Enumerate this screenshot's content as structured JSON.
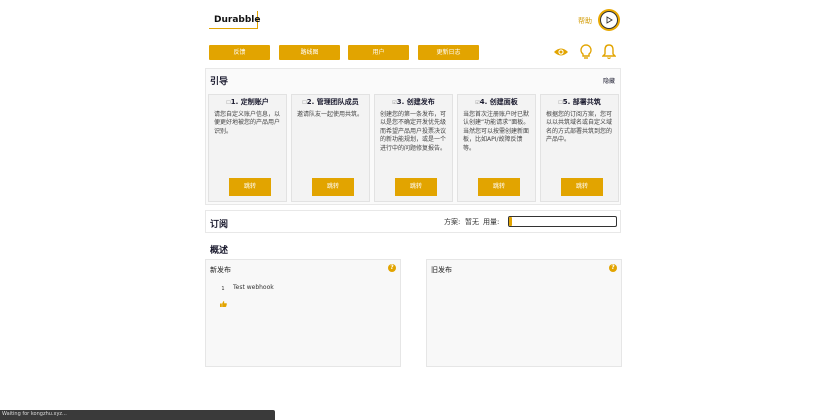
{
  "header": {
    "brand": "Durabble",
    "help_label": "帮助"
  },
  "nav": {
    "buttons": [
      "反馈",
      "路线图",
      "用户",
      "更新日志"
    ]
  },
  "guide": {
    "title": "引导",
    "hide_label": "隐藏",
    "cards": [
      {
        "num": "1. 定制账户",
        "checked": false,
        "desc": "请您自定义账户信息，以便更好地被您的产品用户识别。",
        "button": "跳转"
      },
      {
        "num": "2. 管理团队成员",
        "checked": false,
        "desc": "邀请队友一起使用共筑。",
        "button": "跳转"
      },
      {
        "num": "3. 创建发布",
        "checked": true,
        "desc": "创建您的第一条发布，可以是您不确定开发优先级而希望产品用户投票决议的新功能规划，或是一个进行中的问题修复报告。",
        "button": "跳转"
      },
      {
        "num": "4. 创建面板",
        "checked": true,
        "desc": "当您首次注册账户时已默认创建“功能请求”面板。当然您可以按需创建新面板，比如API/故障反馈等。",
        "button": "跳转"
      },
      {
        "num": "5. 部署共筑",
        "checked": false,
        "desc": "根据您的订阅方案，您可以以共筑域名或自定义域名的方式部署共筑到您的产品中。",
        "button": "跳转"
      }
    ]
  },
  "subscription": {
    "title": "订阅",
    "plan_label": "方案:",
    "plan_value": "暂无",
    "usage_label": "用量:",
    "usage_fraction": 0.03
  },
  "overview": {
    "title": "概述",
    "new_posts": {
      "title": "新发布",
      "items": [
        {
          "votes": "1",
          "title": "Test webhook"
        }
      ]
    },
    "old_posts": {
      "title": "旧发布"
    }
  },
  "statusbar": {
    "text": "Waiting for kongzhu.xyz..."
  },
  "colors": {
    "accent": "#e2a400",
    "heading": "#1a1a2e"
  }
}
